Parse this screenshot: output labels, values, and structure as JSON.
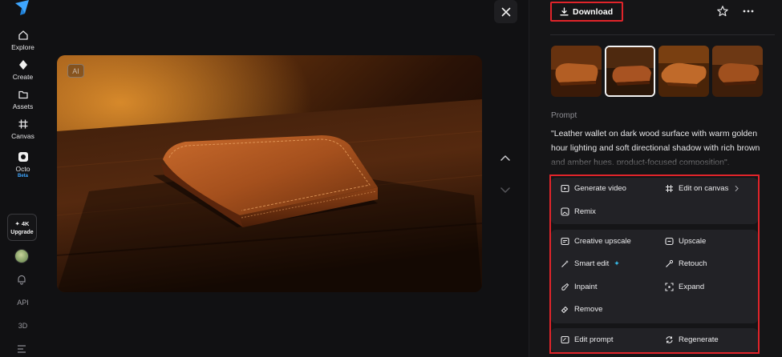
{
  "nav": {
    "items": [
      {
        "label": "Explore",
        "icon": "home-icon"
      },
      {
        "label": "Create",
        "icon": "diamond-icon"
      },
      {
        "label": "Assets",
        "icon": "folder-icon"
      },
      {
        "label": "Canvas",
        "icon": "canvas-grid-icon"
      },
      {
        "label": "Octo",
        "icon": "octo-icon"
      }
    ],
    "beta_badge": "Beta",
    "upgrade": {
      "line1": "✦ 4K",
      "line2": "Upgrade"
    },
    "api": "API",
    "d3": "3D"
  },
  "viewer": {
    "ai_badge": "AI"
  },
  "panel": {
    "download_label": "Download",
    "prompt_label": "Prompt",
    "prompt_text": "\"Leather wallet on dark wood surface with warm golden hour lighting and soft directional shadow with rich brown and amber hues, product-focused composition\".",
    "actions": {
      "generate_video": "Generate video",
      "edit_on_canvas": "Edit on canvas",
      "remix": "Remix",
      "creative_upscale": "Creative upscale",
      "upscale": "Upscale",
      "smart_edit": "Smart edit",
      "retouch": "Retouch",
      "inpaint": "Inpaint",
      "expand": "Expand",
      "remove": "Remove",
      "edit_prompt": "Edit prompt",
      "regenerate": "Regenerate"
    }
  },
  "colors": {
    "highlight_red": "#e0242a",
    "accent_blue": "#37b8e6"
  }
}
